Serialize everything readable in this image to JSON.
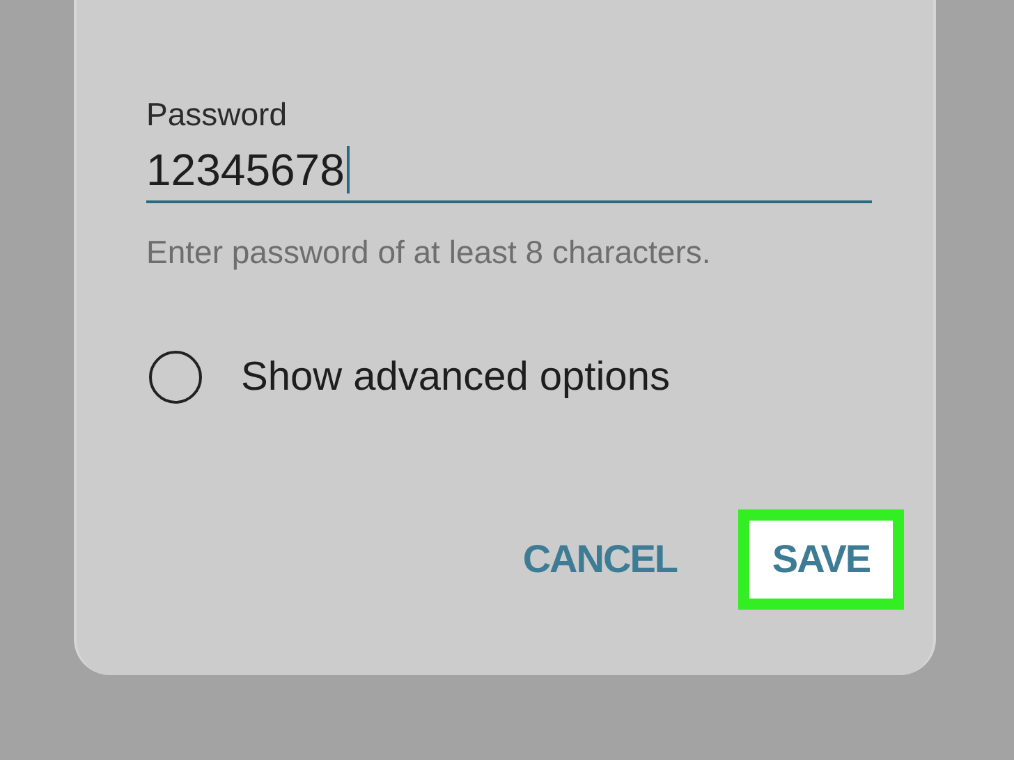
{
  "dialog": {
    "field": {
      "label": "Password",
      "value": "12345678",
      "helper": "Enter password of at least 8 characters."
    },
    "advanced_option": {
      "label": "Show advanced options",
      "checked": false
    },
    "buttons": [
      {
        "label": "CANCEL",
        "highlighted": false
      },
      {
        "label": "SAVE",
        "highlighted": true
      }
    ]
  }
}
